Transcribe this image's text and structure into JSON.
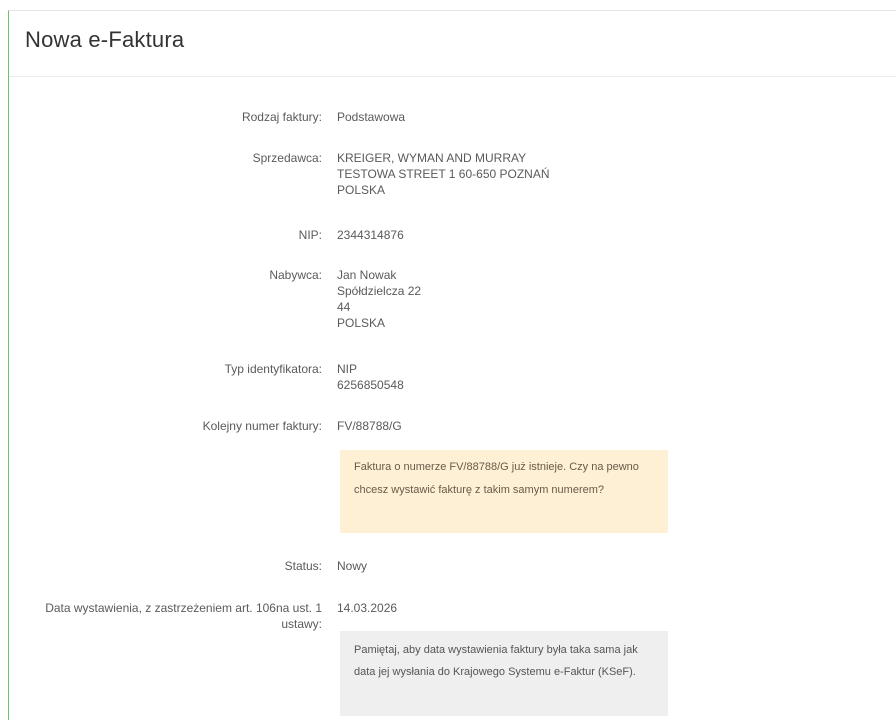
{
  "header": {
    "title": "Nowa e-Faktura"
  },
  "form": {
    "invoice_type": {
      "label": "Rodzaj faktury:",
      "value": "Podstawowa"
    },
    "seller": {
      "label": "Sprzedawca:",
      "lines": [
        "KREIGER, WYMAN AND MURRAY",
        "TESTOWA STREET 1 60-650 POZNAŃ",
        "POLSKA"
      ]
    },
    "nip": {
      "label": "NIP:",
      "value": "2344314876"
    },
    "buyer": {
      "label": "Nabywca:",
      "lines": [
        "Jan Nowak",
        "Spółdzielcza 22",
        "44",
        "POLSKA"
      ]
    },
    "id_type": {
      "label": "Typ identyfikatora:",
      "lines": [
        "NIP",
        "6256850548"
      ]
    },
    "invoice_number": {
      "label": "Kolejny numer faktury:",
      "value": "FV/88788/G",
      "warning": "Faktura o numerze FV/88788/G już istnieje. Czy na pewno chcesz wystawić fakturę z takim samym numerem?"
    },
    "status": {
      "label": "Status:",
      "value": "Nowy"
    },
    "issue_date": {
      "label": "Data wystawienia, z zastrzeżeniem art. 106na ust. 1 ustawy:",
      "value": "14.03.2026",
      "info": "Pamiętaj, aby data wystawienia faktury była taka sama jak data jej wysłania do Krajowego Systemu e-Faktur (KSeF)."
    }
  },
  "colors": {
    "accent_border": "#6cc36a",
    "warning_bg": "#fdf0d5",
    "info_bg": "#efefef"
  }
}
